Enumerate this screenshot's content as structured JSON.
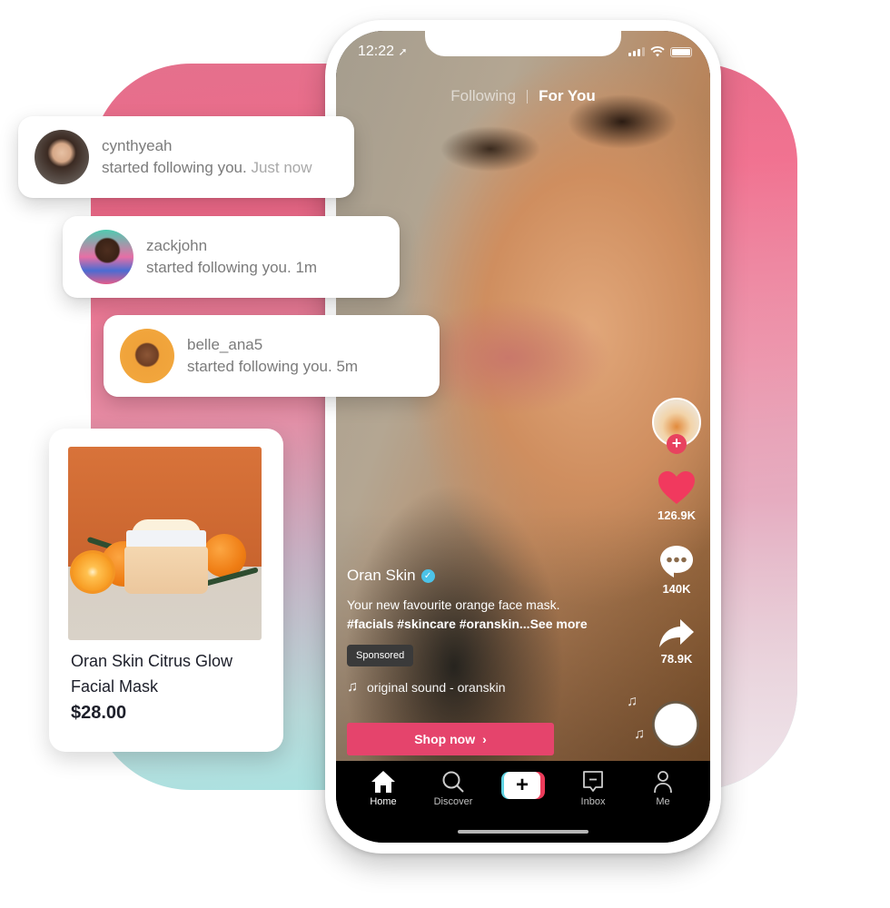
{
  "status_bar": {
    "time": "12:22",
    "location_icon": "location-arrow-icon",
    "icons": [
      "signal-icon",
      "wifi-icon",
      "battery-icon"
    ]
  },
  "feed_tabs": {
    "following": "Following",
    "for_you": "For You",
    "active": "For You"
  },
  "notifications": [
    {
      "username": "cynthyeah",
      "message": "started following you.",
      "time": "Just now"
    },
    {
      "username": "zackjohn",
      "message": "started following you.",
      "time": "1m"
    },
    {
      "username": "belle_ana5",
      "message": "started following you.",
      "time": "5m"
    }
  ],
  "product_card": {
    "name": "Oran Skin Citrus Glow Facial Mask",
    "price": "$28.00",
    "image": "product-photo"
  },
  "video": {
    "creator": "Oran Skin",
    "verified": true,
    "description": "Your new favourite orange face mask.",
    "hashtags": "#facials #skincare #oranskin...See more",
    "sponsored_label": "Sponsored",
    "sound": "original sound - oranskin",
    "cta_label": "Shop now",
    "cta_icon": "chevron-right-icon"
  },
  "side_actions": {
    "follow_icon": "plus-icon",
    "likes": "126.9K",
    "comments": "140K",
    "shares": "78.9K"
  },
  "bottom_nav": {
    "items": [
      {
        "label": "Home",
        "icon": "home-icon",
        "active": true
      },
      {
        "label": "Discover",
        "icon": "search-icon",
        "active": false
      },
      {
        "label": "",
        "icon": "create-plus-icon",
        "active": false
      },
      {
        "label": "Inbox",
        "icon": "inbox-icon",
        "active": false
      },
      {
        "label": "Me",
        "icon": "profile-icon",
        "active": false
      }
    ]
  },
  "colors": {
    "accent_pink": "#e5446c",
    "like_red": "#f1395e",
    "verified_blue": "#4cc3e8",
    "create_cyan": "#5fd3e3",
    "create_red": "#ec3b5a"
  }
}
